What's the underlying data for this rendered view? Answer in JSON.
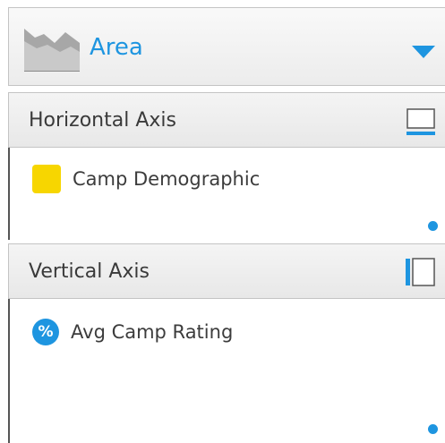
{
  "chart_type": {
    "label": "Area",
    "icon": "area-chart-icon",
    "caret_icon": "chevron-down-icon"
  },
  "horizontal_axis": {
    "title": "Horizontal Axis",
    "icon": "horizontal-axis-icon",
    "fields": [
      {
        "label": "Camp Demographic",
        "icon": "dimension-swatch",
        "color": "#f7d600"
      }
    ]
  },
  "vertical_axis": {
    "title": "Vertical Axis",
    "icon": "vertical-axis-icon",
    "fields": [
      {
        "label": "Avg Camp Rating",
        "icon": "percent-icon",
        "color": "#1e95e0"
      }
    ]
  },
  "colors": {
    "accent": "#1e95e0",
    "dimension": "#f7d600"
  }
}
